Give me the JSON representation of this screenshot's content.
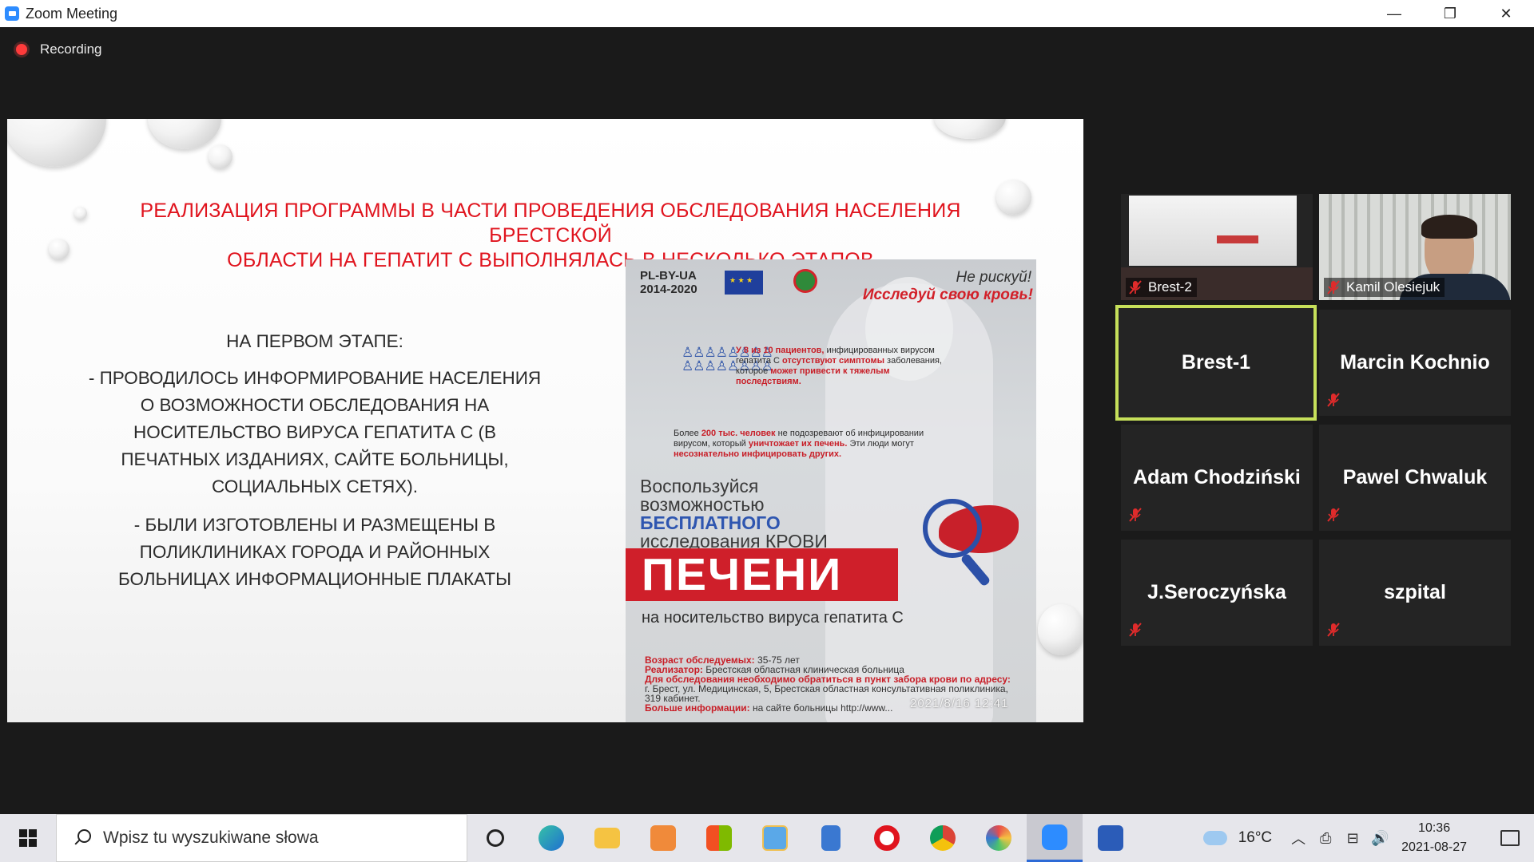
{
  "window": {
    "title": "Zoom Meeting",
    "minimize_glyph": "—",
    "restore_glyph": "❐",
    "close_glyph": "✕"
  },
  "recording": {
    "label": "Recording"
  },
  "slide": {
    "title_line1": "РЕАЛИЗАЦИЯ ПРОГРАММЫ В ЧАСТИ ПРОВЕДЕНИЯ ОБСЛЕДОВАНИЯ НАСЕЛЕНИЯ БРЕСТСКОЙ",
    "title_line2": "ОБЛАСТИ НА ГЕПАТИТ С  ВЫПОЛНЯЛАСЬ В НЕСКОЛЬКО ЭТАПОВ",
    "stage_heading": "НА ПЕРВОМ ЭТАПЕ:",
    "bullet1": "-  ПРОВОДИЛОСЬ ИНФОРМИРОВАНИЕ НАСЕЛЕНИЯ О ВОЗМОЖНОСТИ ОБСЛЕДОВАНИЯ НА НОСИТЕЛЬСТВО ВИРУСА ГЕПАТИТА С (В ПЕЧАТНЫХ ИЗДАНИЯХ, САЙТЕ БОЛЬНИЦЫ, СОЦИАЛЬНЫХ СЕТЯХ).",
    "bullet2": "- БЫЛИ ИЗГОТОВЛЕНЫ И РАЗМЕЩЕНЫ В ПОЛИКЛИНИКАХ ГОРОДА И РАЙОННЫХ БОЛЬНИЦАХ ИНФОРМАЦИОННЫЕ ПЛАКАТЫ",
    "poster": {
      "brand_line1": "PL-BY-UA",
      "brand_line2": "2014-2020",
      "slogan1": "Не рискуй!",
      "slogan2": "Исследуй свою кровь!",
      "people_glyph": "♙♙♙♙♙♙♙♙",
      "stat1_a": "У 8 из 10 пациентов,",
      "stat1_b": "инфицированных вирусом гепатита С",
      "stat1_c": "отсутствуют симптомы",
      "stat1_d": "заболевания, которое",
      "stat1_e": "может привести к тяжелым последствиям.",
      "stat2_a": "Более",
      "stat2_b": "200 тыс. человек",
      "stat2_c": "не подозревают об инфицировании вирусом, который",
      "stat2_d": "уничтожает их печень.",
      "stat2_e": "Эти люди могут",
      "stat2_f": "несознательно инфицировать других.",
      "use_line1": "Воспользуйся",
      "use_line2": "возможностью",
      "use_free": "БЕСПЛАТНОГО",
      "use_line3": "исследования КРОВИ",
      "banner": "ПЕЧЕНИ",
      "carrier": "на носительство вируса гепатита С",
      "info_age_label": "Возраст обследуемых:",
      "info_age": "35-75 лет",
      "info_impl_label": "Реализатор:",
      "info_impl": "Брестская областная клиническая больница",
      "info_how": "Для обследования необходимо обратиться в пункт забора крови по адресу:",
      "info_addr": "г. Брест, ул. Медицинская, 5, Брестская областная консультативная поликлиника, 319 кабинет.",
      "info_more_label": "Больше информации:",
      "info_more": "на сайте больницы http://www...",
      "stamp": "2021/8/16  12:41"
    }
  },
  "participants": [
    {
      "name": "Brest-2",
      "type": "video"
    },
    {
      "name": "Kamil Olesiejuk",
      "type": "video"
    },
    {
      "name": "Brest-1",
      "type": "active"
    },
    {
      "name": "Marcin Kochnio",
      "type": "muted"
    },
    {
      "name": "Adam Chodziński",
      "type": "muted"
    },
    {
      "name": "Pawel Chwaluk",
      "type": "muted"
    },
    {
      "name": "J.Seroczyńska",
      "type": "muted"
    },
    {
      "name": "szpital",
      "type": "muted"
    }
  ],
  "taskbar": {
    "search_placeholder": "Wpisz tu wyszukiwane słowa",
    "weather_temp": "16°C",
    "time": "10:36",
    "date": "2021-08-27",
    "tray_up_glyph": "︿",
    "tray_meet_glyph": "⎙",
    "tray_network_glyph": "⊟",
    "tray_volume_glyph": "🔊",
    "apps": [
      "task-view",
      "edge",
      "file-explorer",
      "media-player",
      "store",
      "photos",
      "calculator",
      "opera",
      "chrome",
      "paint",
      "zoom",
      "word"
    ]
  },
  "colors": {
    "slide_title_red": "#e0141e",
    "active_speaker_border": "#c6e05a",
    "mic_muted_red": "#e02b2b",
    "zoom_blue": "#2d8cff"
  }
}
